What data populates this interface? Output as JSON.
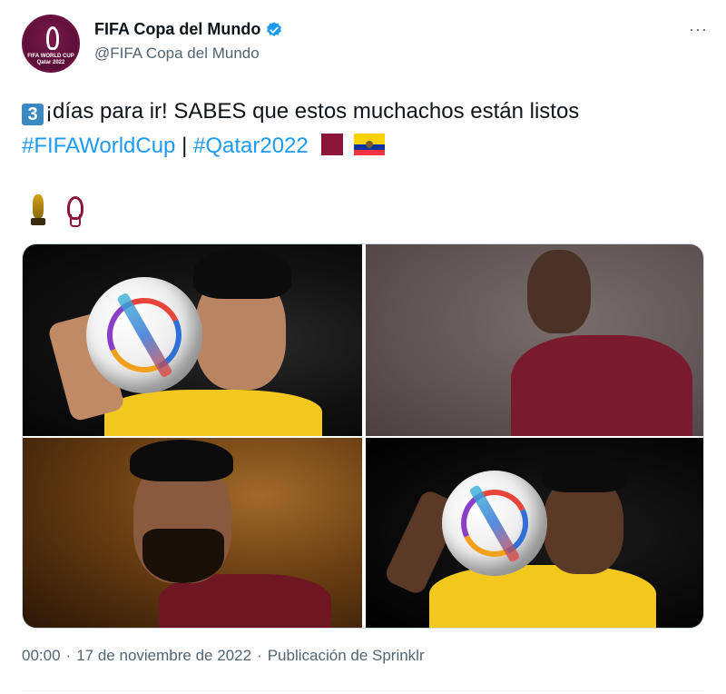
{
  "author": {
    "display_name": "FIFA Copa del Mundo",
    "handle": "@FIFA Copa del Mundo",
    "avatar_text": "FIFA WORLD CUP\nQatar 2022",
    "verified": true,
    "verified_color": "#1d9bf0"
  },
  "more_label": "···",
  "tweet": {
    "keycap": "3",
    "text_part1": "¡días para ir! SABES que estos muchachos están listos ",
    "hashtag1": "#FIFAWorldCup",
    "separator": " | ",
    "hashtag2": "#Qatar2022",
    "emojis": [
      "qatar-flag",
      "ecuador-flag",
      "trophy",
      "world-cup-emblem"
    ]
  },
  "media": {
    "photos": [
      {
        "description_icon": "player-with-ball-ecuador"
      },
      {
        "description_icon": "player-qatar"
      },
      {
        "description_icon": "player-qatar-dark"
      },
      {
        "description_icon": "player-with-ball-ecuador-2"
      }
    ]
  },
  "footer": {
    "time": "00:00",
    "dot1": "·",
    "date": "17 de noviembre de 2022",
    "dot2": "·",
    "source": "Publicación de Sprinklr"
  },
  "colors": {
    "link": "#1d9bf0",
    "secondary_text": "#536471",
    "qatar_maroon": "#8a1538"
  }
}
